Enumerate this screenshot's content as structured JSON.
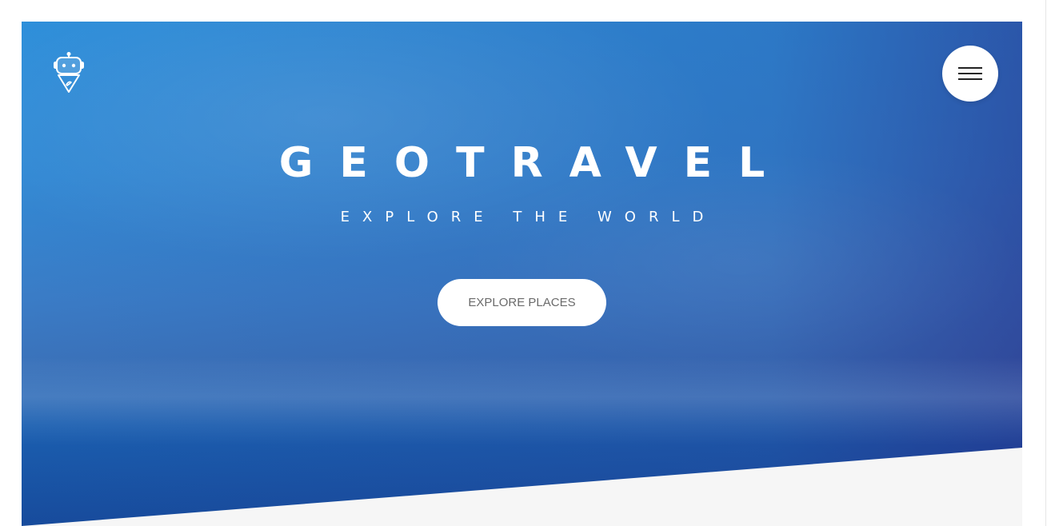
{
  "brand": {
    "logo_icon": "robot-pin-logo-icon"
  },
  "header": {
    "menu_icon": "hamburger-menu-icon"
  },
  "hero": {
    "title": "GEOTRAVEL",
    "subtitle": "EXPLORE THE WORLD",
    "cta_label": "EXPLORE PLACES"
  },
  "colors": {
    "sky_top": "#2e8fda",
    "sky_bottom": "#174b9c",
    "slant_section": "#f6f6f6",
    "button_text": "#6b6b6b"
  }
}
